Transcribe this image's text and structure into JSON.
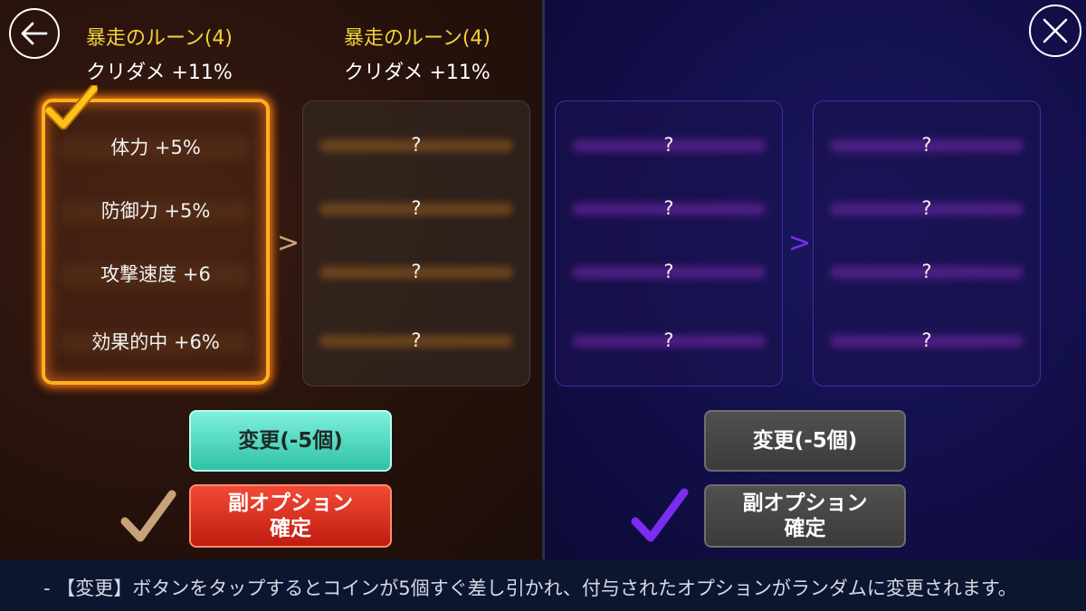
{
  "left_panel": {
    "current": {
      "set_name": "暴走のルーン(4)",
      "set_effect": "クリダメ +11%",
      "options": [
        "体力 +5%",
        "防御力 +5%",
        "攻撃速度 +6",
        "効果的中 +6%"
      ]
    },
    "result": {
      "set_name": "暴走のルーン(4)",
      "set_effect": "クリダメ +11%",
      "options": [
        "?",
        "?",
        "?",
        "?"
      ]
    },
    "arrow": ">",
    "change_button": "変更(-5個)",
    "confirm_button_line1": "副オプション",
    "confirm_button_line2": "確定"
  },
  "right_panel": {
    "current": {
      "options": [
        "?",
        "?",
        "?",
        "?"
      ]
    },
    "result": {
      "options": [
        "?",
        "?",
        "?",
        "?"
      ]
    },
    "arrow": ">",
    "change_button": "変更(-5個)",
    "confirm_button_line1": "副オプション",
    "confirm_button_line2": "確定"
  },
  "footer_text": "-  【変更】ボタンをタップするとコインが5個すぐ差し引かれ、付与されたオプションがランダムに変更されます。",
  "icons": {
    "back": "back-arrow-icon",
    "close": "close-icon",
    "selected_check": "checkmark-icon"
  },
  "colors": {
    "set_name": "#f3d23c",
    "selected_border": "#ffb020",
    "teal_button": "#4fd8bf",
    "red_button": "#d62a1a",
    "gray_button": "#454545",
    "left_bg": "#27120c",
    "right_bg": "#120f4a",
    "purple_accent": "#7a2cf0",
    "tan_check": "#c9a27a"
  }
}
